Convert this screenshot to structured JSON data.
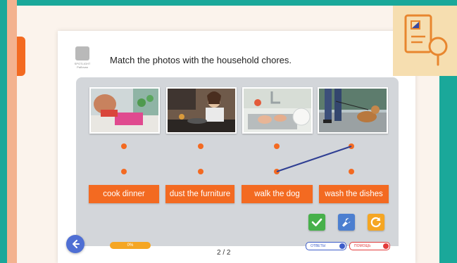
{
  "instruction": "Match the photos with the household chores.",
  "logo": {
    "text": "SPOTLIGHT Рабочая",
    "icon": "publisher-logo"
  },
  "photos": [
    {
      "name": "photo-cleaning"
    },
    {
      "name": "photo-cooking"
    },
    {
      "name": "photo-dishes"
    },
    {
      "name": "photo-dog-walk"
    }
  ],
  "chores": [
    "cook dinner",
    "dust the furniture",
    "walk the dog",
    "wash the dishes"
  ],
  "matches": [
    {
      "photo": 4,
      "chore": 3
    }
  ],
  "buttons": {
    "check": "check-icon",
    "tools": "wrench-icon",
    "reset": "refresh-icon"
  },
  "progress": {
    "label": "0%",
    "value": 0
  },
  "pager": "2 / 2",
  "toggle_a": {
    "label": "ОТВЕТЫ"
  },
  "toggle_b": {
    "label": "ПОМОЩЬ"
  },
  "colors": {
    "accent": "#f36a21",
    "panel": "#d3d6da",
    "teal": "#1aa89a",
    "line": "#2f3f93"
  }
}
